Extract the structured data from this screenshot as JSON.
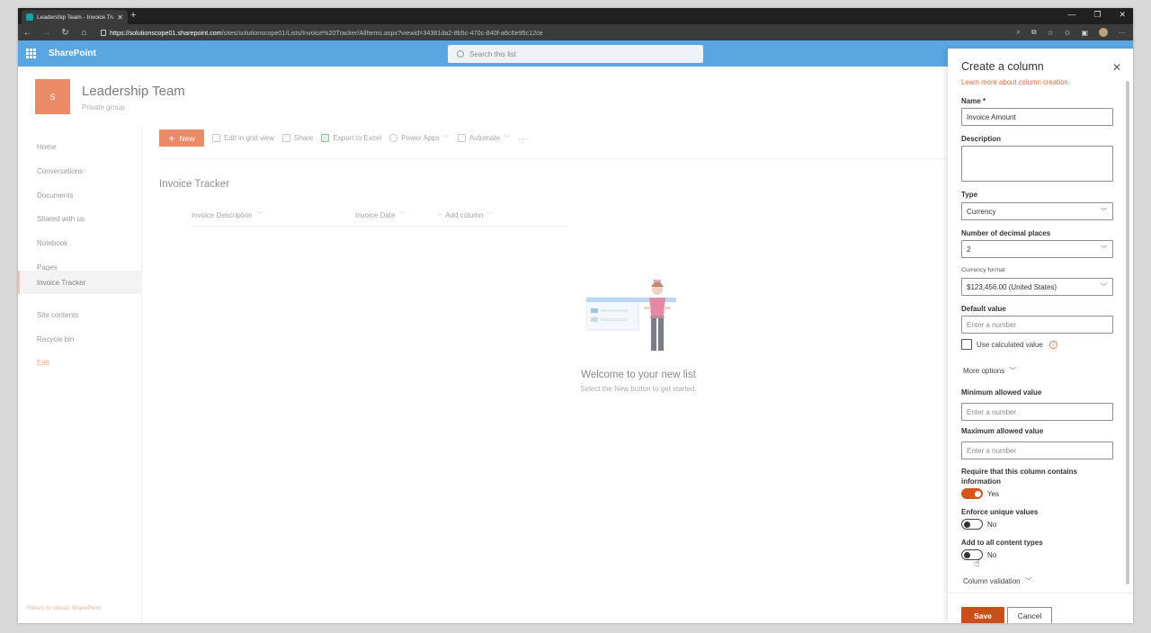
{
  "browser": {
    "tab_title": "Leadership Team - Invoice Tracke",
    "tab_close": "✕",
    "new_tab": "+",
    "url_host": "https://solutionscope01.sharepoint.com",
    "url_path": "/sites/solutionscope01/Lists/Invoice%20Tracker/AllItems.aspx?viewid=34381da2-8b5c-470c-840f-a6c6e95c12ce"
  },
  "suite": {
    "app_name": "SharePoint",
    "search_placeholder": "Search this list"
  },
  "site": {
    "logo_letter": "S",
    "title": "Leadership Team",
    "subtitle": "Private group"
  },
  "nav": {
    "items": [
      {
        "label": "Home"
      },
      {
        "label": "Conversations"
      },
      {
        "label": "Documents"
      },
      {
        "label": "Shared with us"
      },
      {
        "label": "Notebook"
      },
      {
        "label": "Pages"
      },
      {
        "label": "Invoice Tracker",
        "selected": true
      },
      {
        "label": "Site contents"
      },
      {
        "label": "Recycle bin"
      },
      {
        "label": "Edit"
      }
    ],
    "classic_link": "Return to classic SharePoint"
  },
  "commands": {
    "new": "New",
    "edit_grid": "Edit in grid view",
    "share": "Share",
    "export": "Export to Excel",
    "power_apps": "Power Apps",
    "automate": "Automate",
    "more": "···"
  },
  "list": {
    "title": "Invoice Tracker",
    "columns": [
      "Invoice Description",
      "Invoice Date",
      "Add column"
    ],
    "empty_title": "Welcome to your new list",
    "empty_sub": "Select the New button to get started."
  },
  "panel": {
    "title": "Create a column",
    "learn_more": "Learn more about column creation.",
    "name_label": "Name *",
    "name_value": "Invoice Amount",
    "description_label": "Description",
    "type_label": "Type",
    "type_value": "Currency",
    "decimals_label": "Number of decimal places",
    "decimals_value": "2",
    "currency_format_label": "Currency format",
    "currency_format_value": "$123,456.00 (United States)",
    "default_label": "Default value",
    "default_placeholder": "Enter a number",
    "use_calculated": "Use calculated value",
    "more_options": "More options",
    "min_label": "Minimum allowed value",
    "min_placeholder": "Enter a number",
    "max_label": "Maximum allowed value",
    "max_placeholder": "Enter a number",
    "require_label": "Require that this column contains information",
    "require_state": "Yes",
    "unique_label": "Enforce unique values",
    "unique_state": "No",
    "content_types_label": "Add to all content types",
    "content_types_state": "No",
    "column_validation": "Column validation",
    "save": "Save",
    "cancel": "Cancel"
  },
  "colors": {
    "accent": "#eb8a66",
    "save": "#c84e1c",
    "suite_bar": "#5aa6e0"
  }
}
